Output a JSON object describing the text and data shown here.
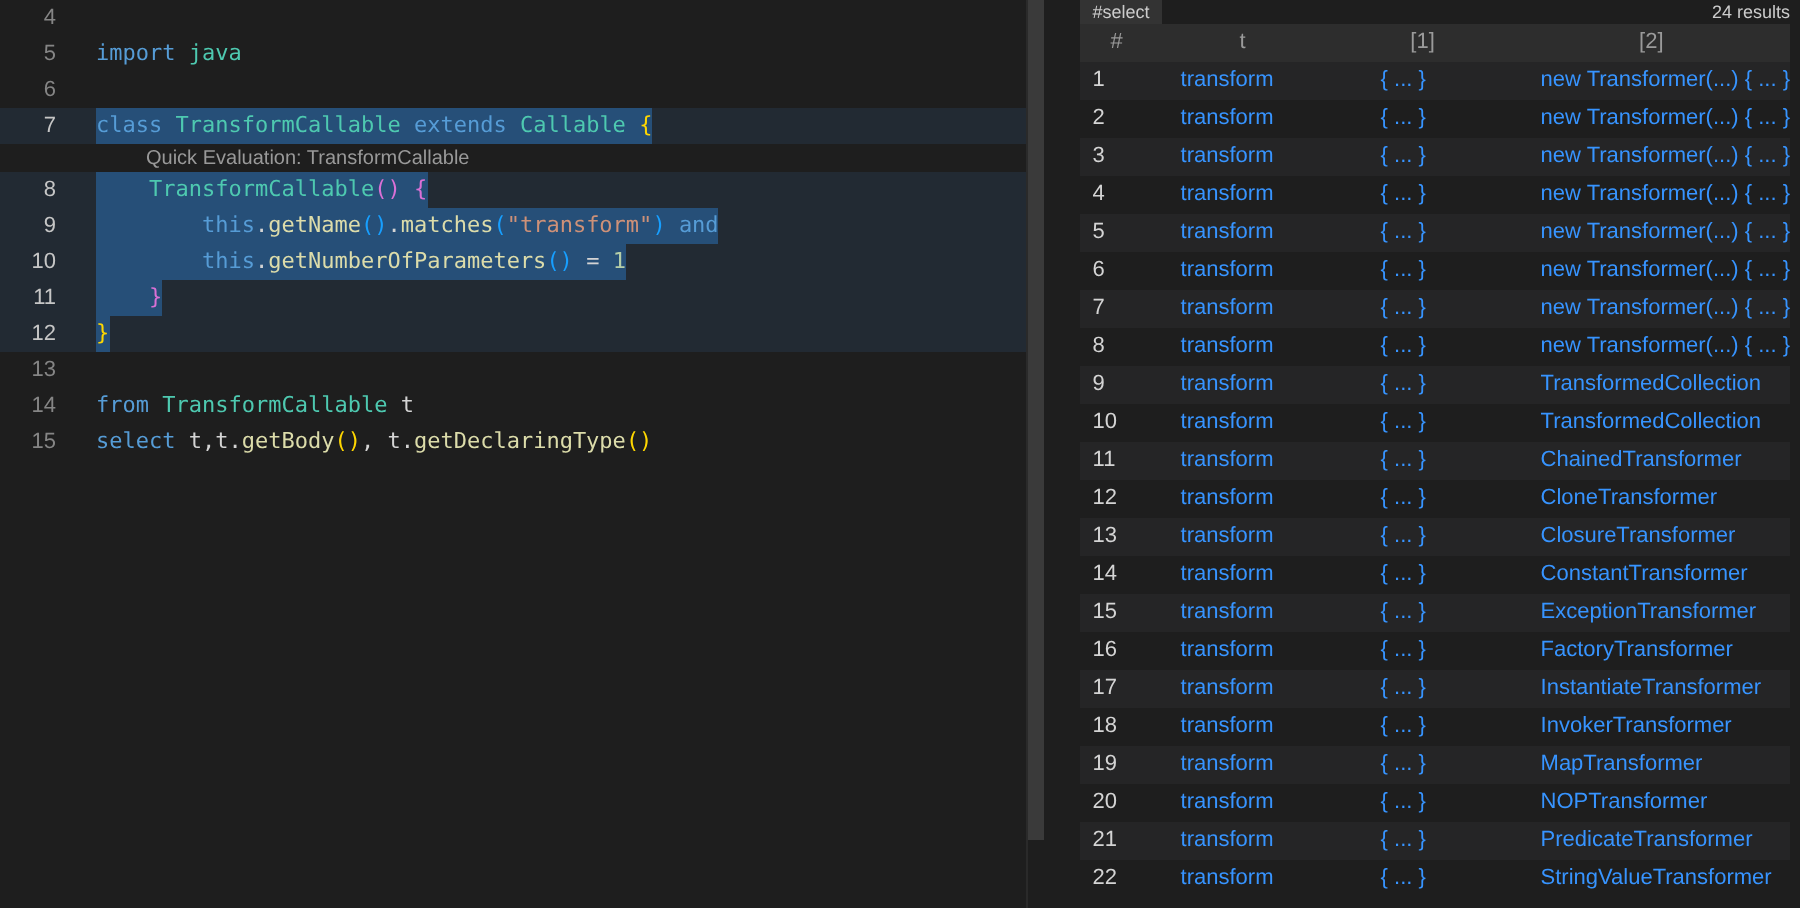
{
  "editor": {
    "lines": [
      {
        "number": "4",
        "selected": false
      },
      {
        "number": "5",
        "selected": false,
        "tokens": [
          {
            "kind": "keyword",
            "text": "import "
          },
          {
            "kind": "type",
            "text": "java"
          }
        ]
      },
      {
        "number": "6",
        "selected": false
      },
      {
        "number": "7",
        "selected": true,
        "tokens": [
          {
            "kind": "keyword",
            "text": "class "
          },
          {
            "kind": "type",
            "text": "TransformCallable "
          },
          {
            "kind": "keyword",
            "text": "extends "
          },
          {
            "kind": "type",
            "text": "Callable "
          },
          {
            "kind": "brace1",
            "text": "{"
          }
        ],
        "codelens": "Quick Evaluation: TransformCallable"
      },
      {
        "number": "8",
        "selected": true,
        "tokens": [
          {
            "kind": "type",
            "text": "    TransformCallable"
          },
          {
            "kind": "brace2",
            "text": "() {"
          }
        ]
      },
      {
        "number": "9",
        "selected": true,
        "tokens": [
          {
            "kind": "keyword",
            "text": "        this"
          },
          {
            "kind": "plain",
            "text": "."
          },
          {
            "kind": "method",
            "text": "getName"
          },
          {
            "kind": "brace3",
            "text": "()"
          },
          {
            "kind": "plain",
            "text": "."
          },
          {
            "kind": "method",
            "text": "matches"
          },
          {
            "kind": "brace3",
            "text": "("
          },
          {
            "kind": "string",
            "text": "\"transform\""
          },
          {
            "kind": "brace3",
            "text": ") "
          },
          {
            "kind": "keyword",
            "text": "and"
          }
        ]
      },
      {
        "number": "10",
        "selected": true,
        "tokens": [
          {
            "kind": "keyword",
            "text": "        this"
          },
          {
            "kind": "plain",
            "text": "."
          },
          {
            "kind": "method",
            "text": "getNumberOfParameters"
          },
          {
            "kind": "brace3",
            "text": "() "
          },
          {
            "kind": "plain",
            "text": "= "
          },
          {
            "kind": "number",
            "text": "1"
          }
        ]
      },
      {
        "number": "11",
        "selected": true,
        "tokens": [
          {
            "kind": "brace2",
            "text": "    }"
          }
        ]
      },
      {
        "number": "12",
        "selected": true,
        "tokens": [
          {
            "kind": "brace1",
            "text": "}"
          }
        ]
      },
      {
        "number": "13",
        "selected": false
      },
      {
        "number": "14",
        "selected": false,
        "tokens": [
          {
            "kind": "keyword",
            "text": "from "
          },
          {
            "kind": "type",
            "text": "TransformCallable "
          },
          {
            "kind": "plain",
            "text": "t"
          }
        ]
      },
      {
        "number": "15",
        "selected": false,
        "tokens": [
          {
            "kind": "keyword",
            "text": "select "
          },
          {
            "kind": "plain",
            "text": "t,t."
          },
          {
            "kind": "method",
            "text": "getBody"
          },
          {
            "kind": "brace1",
            "text": "()"
          },
          {
            "kind": "plain",
            "text": ", t."
          },
          {
            "kind": "method",
            "text": "getDeclaringType"
          },
          {
            "kind": "brace1",
            "text": "()"
          }
        ]
      }
    ]
  },
  "results": {
    "tab": "#select",
    "count": "24 results",
    "columns": [
      "#",
      "t",
      "[1]",
      "[2]"
    ],
    "rows": [
      [
        "1",
        "transform",
        "{ ... }",
        "new Transformer(...) { ... }"
      ],
      [
        "2",
        "transform",
        "{ ... }",
        "new Transformer(...) { ... }"
      ],
      [
        "3",
        "transform",
        "{ ... }",
        "new Transformer(...) { ... }"
      ],
      [
        "4",
        "transform",
        "{ ... }",
        "new Transformer(...) { ... }"
      ],
      [
        "5",
        "transform",
        "{ ... }",
        "new Transformer(...) { ... }"
      ],
      [
        "6",
        "transform",
        "{ ... }",
        "new Transformer(...) { ... }"
      ],
      [
        "7",
        "transform",
        "{ ... }",
        "new Transformer(...) { ... }"
      ],
      [
        "8",
        "transform",
        "{ ... }",
        "new Transformer(...) { ... }"
      ],
      [
        "9",
        "transform",
        "{ ... }",
        "TransformedCollection"
      ],
      [
        "10",
        "transform",
        "{ ... }",
        "TransformedCollection"
      ],
      [
        "11",
        "transform",
        "{ ... }",
        "ChainedTransformer"
      ],
      [
        "12",
        "transform",
        "{ ... }",
        "CloneTransformer"
      ],
      [
        "13",
        "transform",
        "{ ... }",
        "ClosureTransformer"
      ],
      [
        "14",
        "transform",
        "{ ... }",
        "ConstantTransformer"
      ],
      [
        "15",
        "transform",
        "{ ... }",
        "ExceptionTransformer"
      ],
      [
        "16",
        "transform",
        "{ ... }",
        "FactoryTransformer"
      ],
      [
        "17",
        "transform",
        "{ ... }",
        "InstantiateTransformer"
      ],
      [
        "18",
        "transform",
        "{ ... }",
        "InvokerTransformer"
      ],
      [
        "19",
        "transform",
        "{ ... }",
        "MapTransformer"
      ],
      [
        "20",
        "transform",
        "{ ... }",
        "NOPTransformer"
      ],
      [
        "21",
        "transform",
        "{ ... }",
        "PredicateTransformer"
      ],
      [
        "22",
        "transform",
        "{ ... }",
        "StringValueTransformer"
      ]
    ]
  }
}
